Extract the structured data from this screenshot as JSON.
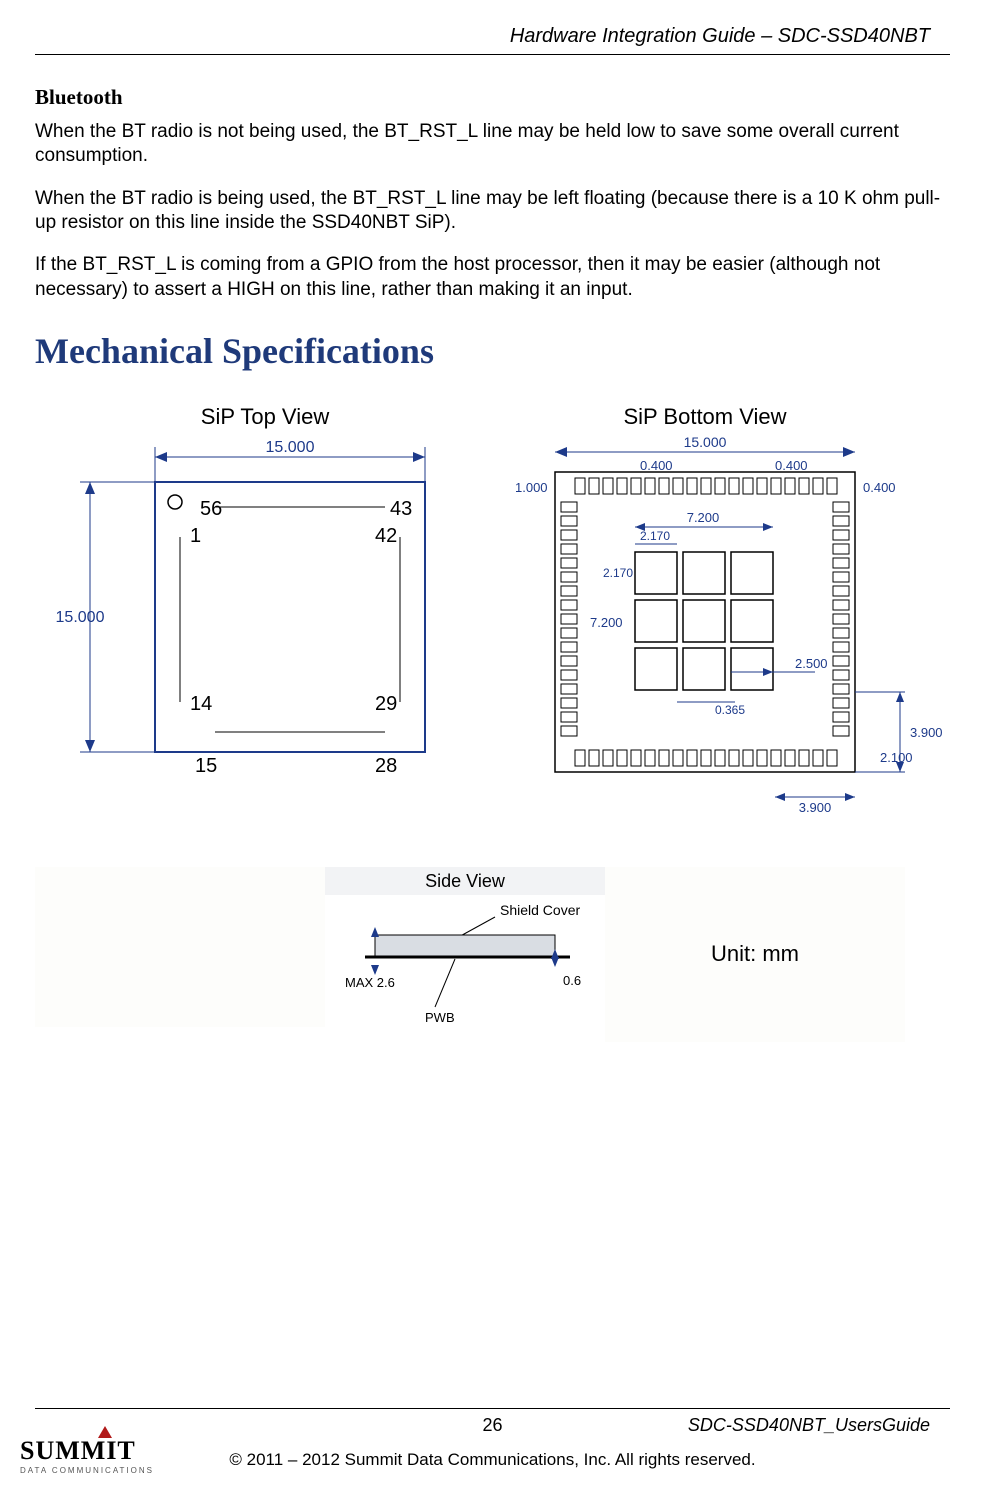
{
  "header": {
    "right": "Hardware Integration Guide – SDC-SSD40NBT"
  },
  "sections": {
    "bluetooth": {
      "title": "Bluetooth",
      "p1": "When the BT radio is not being used, the BT_RST_L line may be held low to save some overall current consumption.",
      "p2": "When the BT radio is being used, the BT_RST_L line may be left floating (because there is a 10 K ohm pull-up resistor on this line inside the SSD40NBT SiP).",
      "p3": "If the BT_RST_L is coming from a GPIO from the host processor, then it may be easier (although not necessary) to assert a HIGH on this line, rather than making it an input."
    },
    "mech": {
      "title": "Mechanical Specifications"
    }
  },
  "diagrams": {
    "top": {
      "title": "SiP Top View",
      "w": "15.000",
      "h": "15.000",
      "pins": {
        "tl": "56",
        "tr": "43",
        "tl2": "1",
        "tr2": "42",
        "bl": "14",
        "br": "29",
        "bl2": "15",
        "br2": "28"
      }
    },
    "bottom": {
      "title": "SiP Bottom View",
      "w": "15.000",
      "pad_w": "0.400",
      "pad_w2": "0.400",
      "edge": "1.000",
      "edge_r": "0.400",
      "center": "7.200",
      "cw": "2.170",
      "ch": "2.170",
      "cgap": "0.365",
      "pad_sq": "2.500",
      "ext_h": "3.900",
      "ext_w": "3.900",
      "ext_mid": "2.100",
      "c2": "7.200"
    },
    "side": {
      "title": "Side View",
      "shield": "Shield Cover",
      "pwb": "PWB",
      "max": "MAX 2.6",
      "board": "0.6"
    },
    "unit": "Unit: mm"
  },
  "footer": {
    "page": "26",
    "right": "SDC-SSD40NBT_UsersGuide",
    "copyright": "© 2011 – 2012 Summit Data Communications, Inc. All rights reserved.",
    "logo_main": "SUMMIT",
    "logo_sub": "DATA COMMUNICATIONS"
  }
}
